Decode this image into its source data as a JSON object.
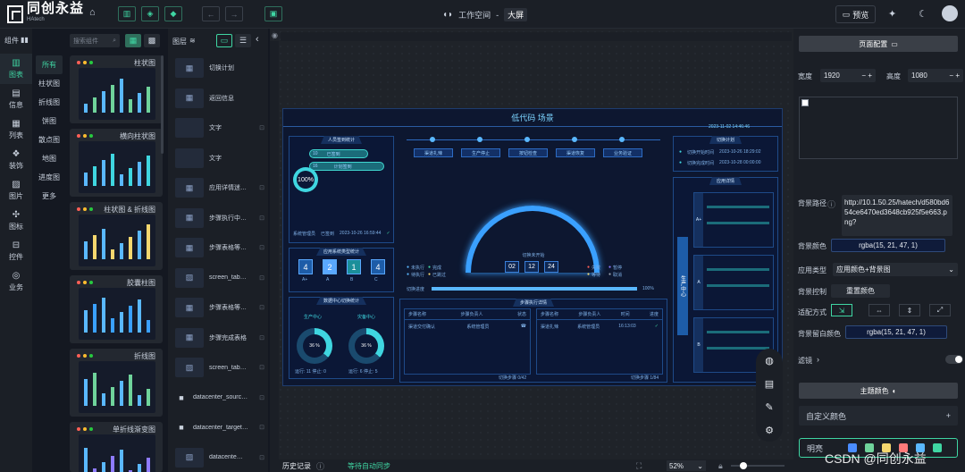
{
  "app": {
    "logo_text": "同创永益",
    "logo_sub": "HAtech"
  },
  "topbar": {
    "workspace_label": "工作空间",
    "workspace_sep": "-",
    "workspace_tag": "大屏",
    "preview_label": "预览"
  },
  "leftrail": {
    "title": "组件",
    "items": [
      {
        "label": "图表",
        "icon": "chart-icon"
      },
      {
        "label": "信息",
        "icon": "info-icon"
      },
      {
        "label": "列表",
        "icon": "table-icon"
      },
      {
        "label": "装饰",
        "icon": "decor-icon"
      },
      {
        "label": "图片",
        "icon": "image-icon"
      },
      {
        "label": "图标",
        "icon": "icons-icon"
      },
      {
        "label": "控件",
        "icon": "control-icon"
      },
      {
        "label": "业务",
        "icon": "business-icon"
      }
    ]
  },
  "components": {
    "search_placeholder": "搜索组件",
    "sub_items": [
      "所有",
      "柱状图",
      "折线图",
      "饼图",
      "散点图",
      "地图",
      "进度图",
      "更多"
    ],
    "cards": [
      "柱状图",
      "横向柱状图",
      "柱状图 & 折线图",
      "胶囊柱图",
      "折线图",
      "单折线渐变图"
    ]
  },
  "layers": {
    "title": "图层",
    "items": [
      {
        "name": "切换计划",
        "lock": false,
        "thumb": "chart"
      },
      {
        "name": "返回信息",
        "lock": false,
        "thumb": "chart"
      },
      {
        "name": "文字",
        "lock": true,
        "thumb": "text"
      },
      {
        "name": "文字",
        "lock": false,
        "thumb": "text"
      },
      {
        "name": "应用详情迷…",
        "lock": true,
        "thumb": "chart"
      },
      {
        "name": "步骤执行中…",
        "lock": true,
        "thumb": "chart"
      },
      {
        "name": "步骤表格等…",
        "lock": true,
        "thumb": "chart"
      },
      {
        "name": "screen_tab…",
        "lock": true,
        "thumb": "image"
      },
      {
        "name": "步骤表格等…",
        "lock": true,
        "thumb": "chart"
      },
      {
        "name": "步骤完成表格",
        "lock": true,
        "thumb": "chart"
      },
      {
        "name": "screen_tab…",
        "lock": true,
        "thumb": "image"
      },
      {
        "name": "datacenter_sourc…",
        "lock": true,
        "thumb": "folder"
      },
      {
        "name": "datacenter_target…",
        "lock": true,
        "thumb": "folder"
      },
      {
        "name": "datacente…",
        "lock": true,
        "thumb": "image"
      }
    ]
  },
  "screen": {
    "title": "低代码 场景",
    "time": "2023-11-02 14:46:46",
    "box1": {
      "title": "人员签到统计",
      "pct": "100%",
      "bar1": "10",
      "bar2": "16",
      "bar1_label": "已签到",
      "bar2_label": "计划签到",
      "foot": "系统管理员",
      "foot2": "已签到",
      "foot3": "2023-10-26 16:59:44"
    },
    "box2": {
      "title": "应用系统类型统计",
      "stats": [
        {
          "v": "4",
          "l": "A+"
        },
        {
          "v": "2",
          "l": "A"
        },
        {
          "v": "1",
          "l": "B"
        },
        {
          "v": "4",
          "l": "C"
        }
      ]
    },
    "box3": {
      "title": "数据中心切换统计",
      "c1": "生产中心",
      "c2": "灾备中心",
      "p1": "36 %",
      "p2": "36 %",
      "f1": "运行: 11 停止: 0",
      "f2": "运行: 6 停止: 5"
    },
    "steps": [
      "渠道扎辣",
      "生产停止",
      "按钮检查",
      "渠道恢复",
      "业务验证"
    ],
    "timer_label": "切换未开始",
    "timer": [
      "02",
      "12",
      "24"
    ],
    "legend": [
      "未执行",
      "完成",
      "待执行",
      "已跳过",
      "失败",
      "暂停",
      "等待",
      "取消"
    ],
    "progress_label": "切换进度",
    "progress_value": "100%",
    "right_box": {
      "title": "切换计划",
      "r1": "切换开始时间",
      "r1v": "2023-10-26 18:29:02",
      "r2": "切换完成时间",
      "r2v": "2023-10-28 00:00:00"
    },
    "app_box": {
      "title": "应用详情",
      "tab": "生产中心",
      "levels": [
        "A+",
        "A",
        "B"
      ]
    },
    "table": {
      "title": "步骤执行详情",
      "cols1": [
        "步骤名称",
        "步骤负责人",
        "状态"
      ],
      "row1": [
        "渠道交付确认",
        "系统管理员"
      ],
      "cols2": [
        "步骤名称",
        "步骤负责人",
        "时间",
        "进度"
      ],
      "row2": [
        "渠道扎辣",
        "系统管理员",
        "16:13:03"
      ],
      "foot1": "切换步骤 0/42",
      "foot2": "切换步骤 1/84"
    }
  },
  "bottombar": {
    "history_label": "历史记录",
    "status": "等待自动同步",
    "zoom": "52%"
  },
  "right": {
    "page_config_label": "页面配置",
    "width_label": "宽度",
    "width_value": "1920",
    "height_label": "高度",
    "height_value": "1080",
    "bg_path_label": "背景路径",
    "bg_path_value": "http://10.1.50.25/hatech/d580bd654ce6470ed3648cb925f5e663.png?",
    "bg_color_label": "背景颜色",
    "bg_color_value": "rgba(15, 21, 47, 1)",
    "apply_type_label": "应用类型",
    "apply_type_value": "应用颜色+背景图",
    "bg_control_label": "背景控制",
    "reset_color_label": "重置颜色",
    "fit_label": "适配方式",
    "blank_color_label": "背景留白颜色",
    "blank_color_value": "rgba(15, 21, 47, 1)",
    "filter_label": "滤镜",
    "theme_label": "主题颜色",
    "custom_color_label": "自定义颜色",
    "theme_name": "明亮",
    "theme_colors": [
      "#4a8cff",
      "#6fd39b",
      "#f5d76e",
      "#ff7a7a",
      "#5ab8ff",
      "#3fd6a3"
    ]
  },
  "watermark": "CSDN @同创永益"
}
